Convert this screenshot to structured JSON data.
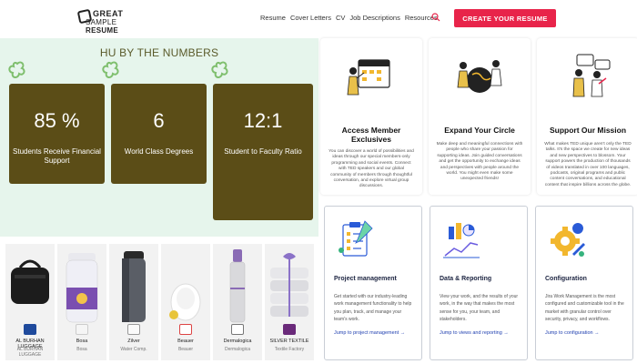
{
  "header": {
    "logo_line1": "GREAT",
    "logo_line2a": "SAMPLE",
    "logo_line2b": "RESUME",
    "nav": [
      "Resume",
      "Cover Letters",
      "CV",
      "Job Descriptions",
      "Resources"
    ],
    "cta_label": "CREATE YOUR RESUME",
    "accent_color": "#e8244a"
  },
  "numbers": {
    "title": "HU BY THE NUMBERS",
    "stats": [
      {
        "value": "85 %",
        "label": "Students Receive Financial Support"
      },
      {
        "value": "6",
        "label": "World Class Degrees"
      },
      {
        "value": "12:1",
        "label": "Student to Faculty Ratio"
      }
    ],
    "panel_color": "#5b4d17",
    "background_color": "#e6f5ec"
  },
  "products": [
    {
      "name": "AL BURHAN LUGGAGE",
      "brand": "AL BURHAN LUGGAGE"
    },
    {
      "name": "Bosa",
      "brand": "Bosa"
    },
    {
      "name": "Zilver",
      "brand": "Water Comp."
    },
    {
      "name": "Beauer",
      "brand": "Beauer"
    },
    {
      "name": "Dermalogica",
      "brand": "Dermalogica"
    },
    {
      "name": "SILVER TEXTILE",
      "brand": "Textile Factory"
    }
  ],
  "member_cards": [
    {
      "title": "Access Member Exclusives",
      "body": "You can discover a world of possibilities and ideas through our special members-only programming and social events. Connect with TED speakers and our global community of members through thoughtful conversation, and explore virtual group discussions."
    },
    {
      "title": "Expand Your Circle",
      "body": "Make deep and meaningful connections with people who share your passion for supporting ideas. Join guided conversations and get the opportunity to exchange ideas and perspectives with people around the world. You might even make some unexpected friends!"
    },
    {
      "title": "Support Our Mission",
      "body": "What makes TED unique aren't only the TED talks. It's the space we create for new ideas and new perspectives to blossom. Your support powers the production of thousands of videos translated in over 100 languages, podcasts, original programs and public content conversations, and educational content that inspire billions across the globe."
    }
  ],
  "product_cards": [
    {
      "title": "Project management",
      "body": "Get started with our industry-leading work management functionality to help you plan, track, and manage your team's work.",
      "link": "Jump to project management →"
    },
    {
      "title": "Data & Reporting",
      "body": "View your work, and the results of your work, in the way that makes the most sense for you, your team, and stakeholders.",
      "link": "Jump to views and reporting →"
    },
    {
      "title": "Configuration",
      "body": "Jira Work Management is the most configured and customizable tool in the market with granular control over security, privacy, and workflows.",
      "link": "Jump to configuration →"
    }
  ]
}
